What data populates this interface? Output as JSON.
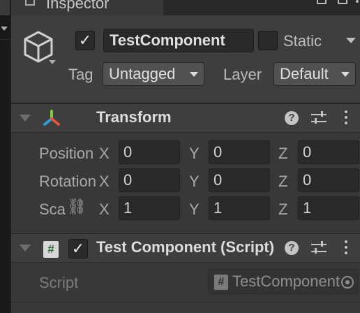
{
  "window": {
    "tab_title": "Inspector"
  },
  "game_object": {
    "active": true,
    "name": "TestComponent",
    "static_label": "Static",
    "static_checked": false,
    "tag_label": "Tag",
    "tag_value": "Untagged",
    "layer_label": "Layer",
    "layer_value": "Default"
  },
  "transform": {
    "title": "Transform",
    "rows": [
      {
        "label": "Position",
        "x": "0",
        "y": "0",
        "z": "0"
      },
      {
        "label": "Rotation",
        "x": "0",
        "y": "0",
        "z": "0"
      },
      {
        "label": "Scale",
        "x": "1",
        "y": "1",
        "z": "1"
      }
    ],
    "axes": {
      "x": "X",
      "y": "Y",
      "z": "Z"
    }
  },
  "test_component": {
    "enabled": true,
    "title": "Test Component (Script)",
    "script_label": "Script",
    "script_value": "TestComponent",
    "script_glyph": "#"
  },
  "icons": {
    "help": "?",
    "checkmark": "✓",
    "link": "⛓"
  },
  "colors": {
    "panel_bg": "#383838",
    "header_bg": "#3e3e3e",
    "field_bg": "#2a2a2a",
    "text": "#c8c8c8"
  }
}
